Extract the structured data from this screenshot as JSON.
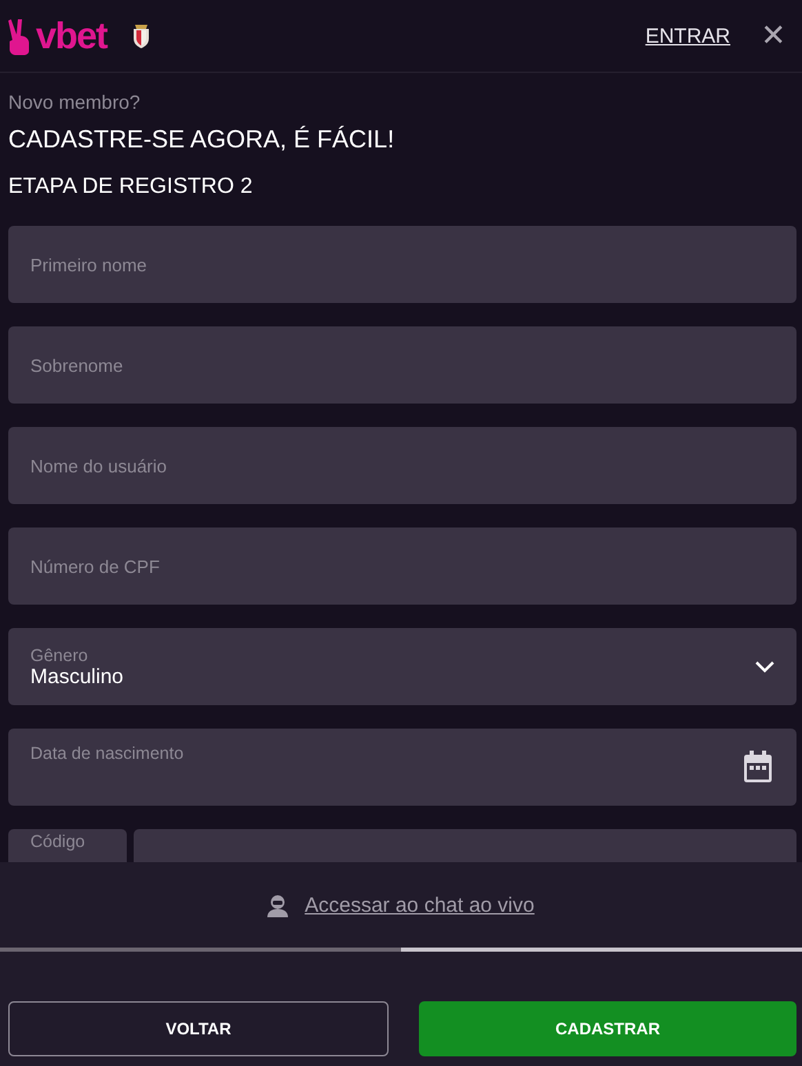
{
  "header": {
    "logo": "vbet",
    "login_link": "ENTRAR",
    "close": "✕"
  },
  "intro": {
    "question": "Novo membro?",
    "title": "CADASTRE-SE AGORA, É FÁCIL!",
    "step": "ETAPA DE REGISTRO 2"
  },
  "fields": [
    {
      "kind": "text",
      "placeholder": "Primeiro nome"
    },
    {
      "kind": "text",
      "placeholder": "Sobrenome"
    },
    {
      "kind": "text",
      "placeholder": "Nome do usuário"
    },
    {
      "kind": "text",
      "placeholder": "Número de CPF"
    },
    {
      "kind": "select",
      "label": "Gênero",
      "value": "Masculino"
    },
    {
      "kind": "date",
      "label": "Data de nascimento"
    },
    {
      "kind": "phone",
      "label": "Código"
    }
  ],
  "chat_link": "Accessar ao chat ao vivo",
  "steps": [
    {
      "selected": false
    },
    {
      "selected": true
    }
  ],
  "buttons": [
    {
      "kind": "secondary",
      "label": "VOLTAR"
    },
    {
      "kind": "primary",
      "label": "CADASTRAR"
    }
  ]
}
